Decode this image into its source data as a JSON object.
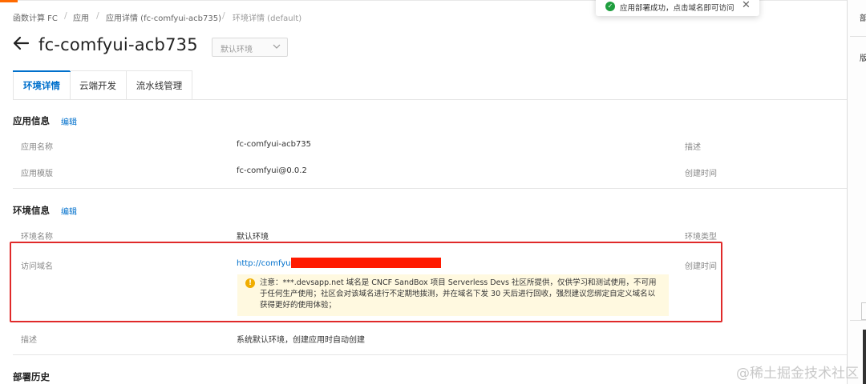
{
  "breadcrumb": {
    "items": [
      "函数计算 FC",
      "应用",
      "应用详情 (fc-comfyui-acb735)",
      "环境详情 (default)"
    ],
    "separator": "/"
  },
  "header": {
    "title": "fc-comfyui-acb735",
    "env_select": "默认环境"
  },
  "tabs": [
    "环境详情",
    "云端开发",
    "流水线管理"
  ],
  "app_info": {
    "title": "应用信息",
    "edit": "编辑",
    "rows": [
      {
        "label": "应用名称",
        "value": "fc-comfyui-acb735",
        "right_label": "描述"
      },
      {
        "label": "应用模版",
        "value": "fc-comfyui@0.0.2",
        "right_label": "创建时间"
      }
    ]
  },
  "env_info": {
    "title": "环境信息",
    "edit": "编辑",
    "name_label": "环境名称",
    "name_value": "默认环境",
    "type_label": "环境类型",
    "domain_label": "访问域名",
    "domain_value": "http://comfyui-",
    "created_label": "创建时间",
    "notice": "注意：***.devsapp.net 域名是 CNCF SandBox 项目 Serverless Devs 社区所提供，仅供学习和测试使用，不可用于任何生产使用；社区会对该域名进行不定期地拨测，并在域名下发 30 天后进行回收，强烈建议您绑定自定义域名以获得更好的使用体验；",
    "desc_label": "描述",
    "desc_value": "系统默认环境，创建应用时自动创建"
  },
  "deploy_history": {
    "title": "部署历史"
  },
  "toast": {
    "message": "应用部署成功，点击域名即可访问",
    "close": "✕"
  },
  "side": {
    "glyph1": "部",
    "glyph2": "版"
  },
  "watermark": "@稀土掘金技术社区",
  "colors": {
    "accent": "#0070cc",
    "highlight": "#e02a2a",
    "notice_bg": "#fff9e0",
    "success": "#1e9e3e",
    "brand": "#ff6a00"
  },
  "icons": {
    "back": "arrow-left-icon",
    "select": "chevron-down-icon",
    "notice": "warning-icon",
    "toast": "check-circle-icon",
    "toast_close": "close-icon"
  }
}
